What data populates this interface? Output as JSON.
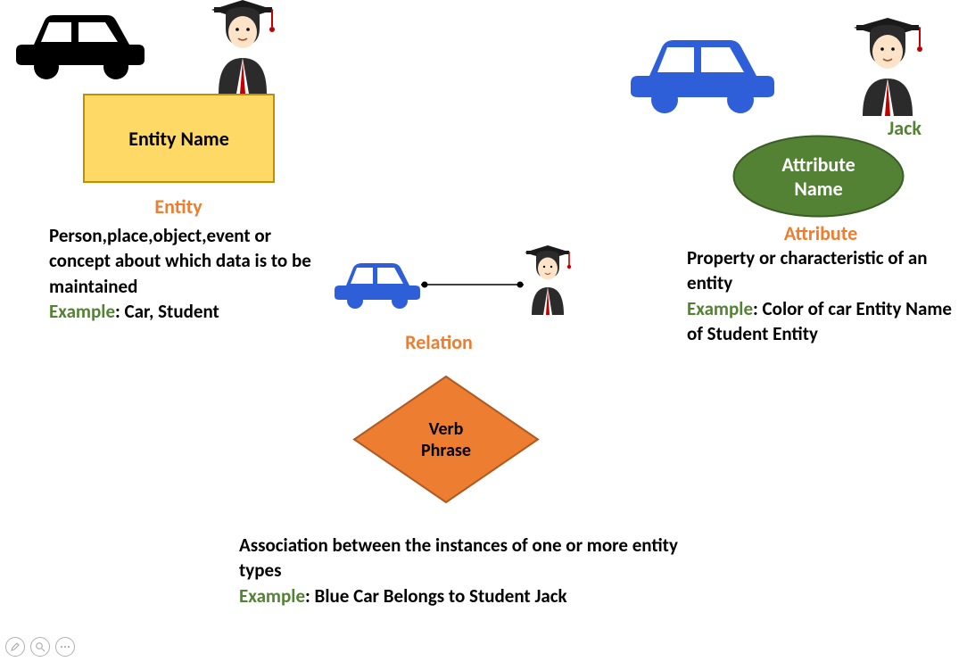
{
  "entity": {
    "shape_label": "Entity Name",
    "title": "Entity",
    "description": "Person,place,object,event or concept about which data is to be maintained",
    "example_label": "Example",
    "example_text": ": Car, Student"
  },
  "attribute": {
    "person_name": "Jack",
    "shape_label": "Attribute Name",
    "title": "Attribute",
    "description": "Property or characteristic of an entity",
    "example_label": "Example",
    "example_text": ": Color of car Entity Name of Student Entity"
  },
  "relation": {
    "title": "Relation",
    "shape_label": "Verb Phrase",
    "description": "Association between the instances of one or more entity types",
    "example_label": "Example",
    "example_text": ": Blue Car Belongs to Student Jack"
  },
  "icons": {
    "car_black": "car-icon",
    "car_blue": "car-icon",
    "student": "student-icon"
  }
}
